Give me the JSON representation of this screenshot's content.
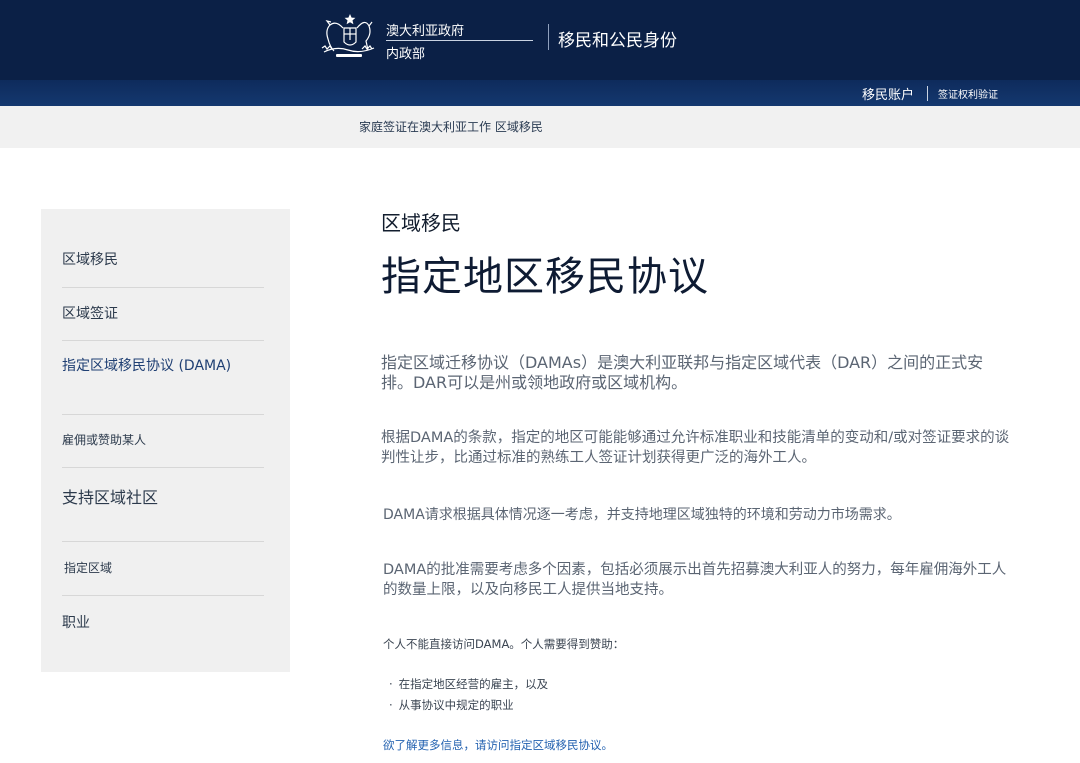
{
  "header": {
    "govt_line1": "澳大利亚政府",
    "govt_line2": "内政部",
    "service_title": "移民和公民身份",
    "logo_icon": "coat-of-arms-icon"
  },
  "nav": {
    "account": "移民账户",
    "visa_check": "签证权利验证"
  },
  "breadcrumb": [
    "家庭签证",
    "在澳大利亚工作",
    "区域移民"
  ],
  "sidebar": {
    "items": [
      {
        "label": "区域移民",
        "active": false
      },
      {
        "label": "区域签证",
        "active": false
      },
      {
        "label": "指定区域移民协议 (DAMA)",
        "active": true
      },
      {
        "label": "雇佣或赞助某人",
        "active": false
      },
      {
        "label": "支持区域社区",
        "active": false
      },
      {
        "label": "指定区域",
        "active": false
      },
      {
        "label": "职业",
        "active": false
      }
    ]
  },
  "content": {
    "kicker": "区域移民",
    "title": "指定地区移民协议",
    "paragraphs": [
      "指定区域迁移协议（DAMAs）是澳大利亚联邦与指定区域代表（DAR）之间的正式安排。DAR可以是州或领地政府或区域机构。",
      "根据DAMA的条款，指定的地区可能能够通过允许标准职业和技能清单的变动和/或对签证要求的谈判性让步，比通过标准的熟练工人签证计划获得更广泛的海外工人。",
      "DAMA请求根据具体情况逐一考虑，并支持地理区域独特的环境和劳动力市场需求。",
      "DAMA的批准需要考虑多个因素，包括必须展示出首先招募澳大利亚人的努力，每年雇佣海外工人的数量上限，以及向移民工人提供当地支持。"
    ],
    "sponsor_note": "个人不能直接访问DAMA。个人需要得到赞助：",
    "bullets": [
      "在指定地区经营的雇主，以及",
      "从事协议中规定的职业"
    ],
    "more_link": "欲了解更多信息，请访问指定区域移民协议。"
  },
  "colors": {
    "header_bg": "#0b2046",
    "navbar_bg": "#14386f",
    "link": "#2462b0",
    "active_nav": "#1f3f73"
  }
}
